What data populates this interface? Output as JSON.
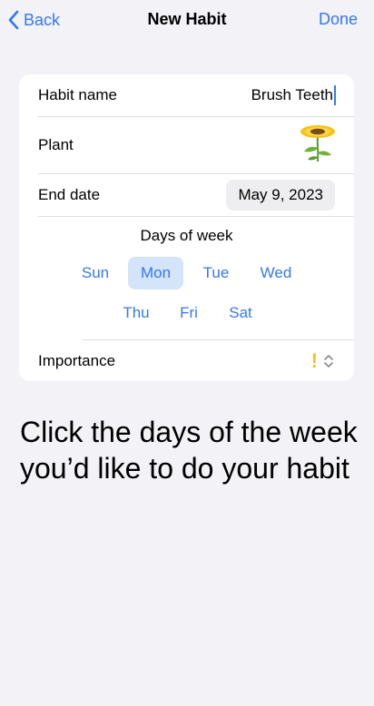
{
  "nav": {
    "back_label": "Back",
    "title": "New Habit",
    "done_label": "Done",
    "accent_color": "#3478f6"
  },
  "form": {
    "habit_name_label": "Habit name",
    "habit_name_value": "Brush Teeth",
    "plant_label": "Plant",
    "plant_icon": "sunflower-icon",
    "end_date_label": "End date",
    "end_date_value": "May 9, 2023",
    "days_title": "Days of week",
    "days": [
      {
        "label": "Sun",
        "selected": false
      },
      {
        "label": "Mon",
        "selected": true
      },
      {
        "label": "Tue",
        "selected": false
      },
      {
        "label": "Wed",
        "selected": false
      },
      {
        "label": "Thu",
        "selected": false
      },
      {
        "label": "Fri",
        "selected": false
      },
      {
        "label": "Sat",
        "selected": false
      }
    ],
    "importance_label": "Importance",
    "importance_value": "!",
    "importance_color": "#f5c518"
  },
  "caption": "Click the days of the week you’d like to do your habit"
}
